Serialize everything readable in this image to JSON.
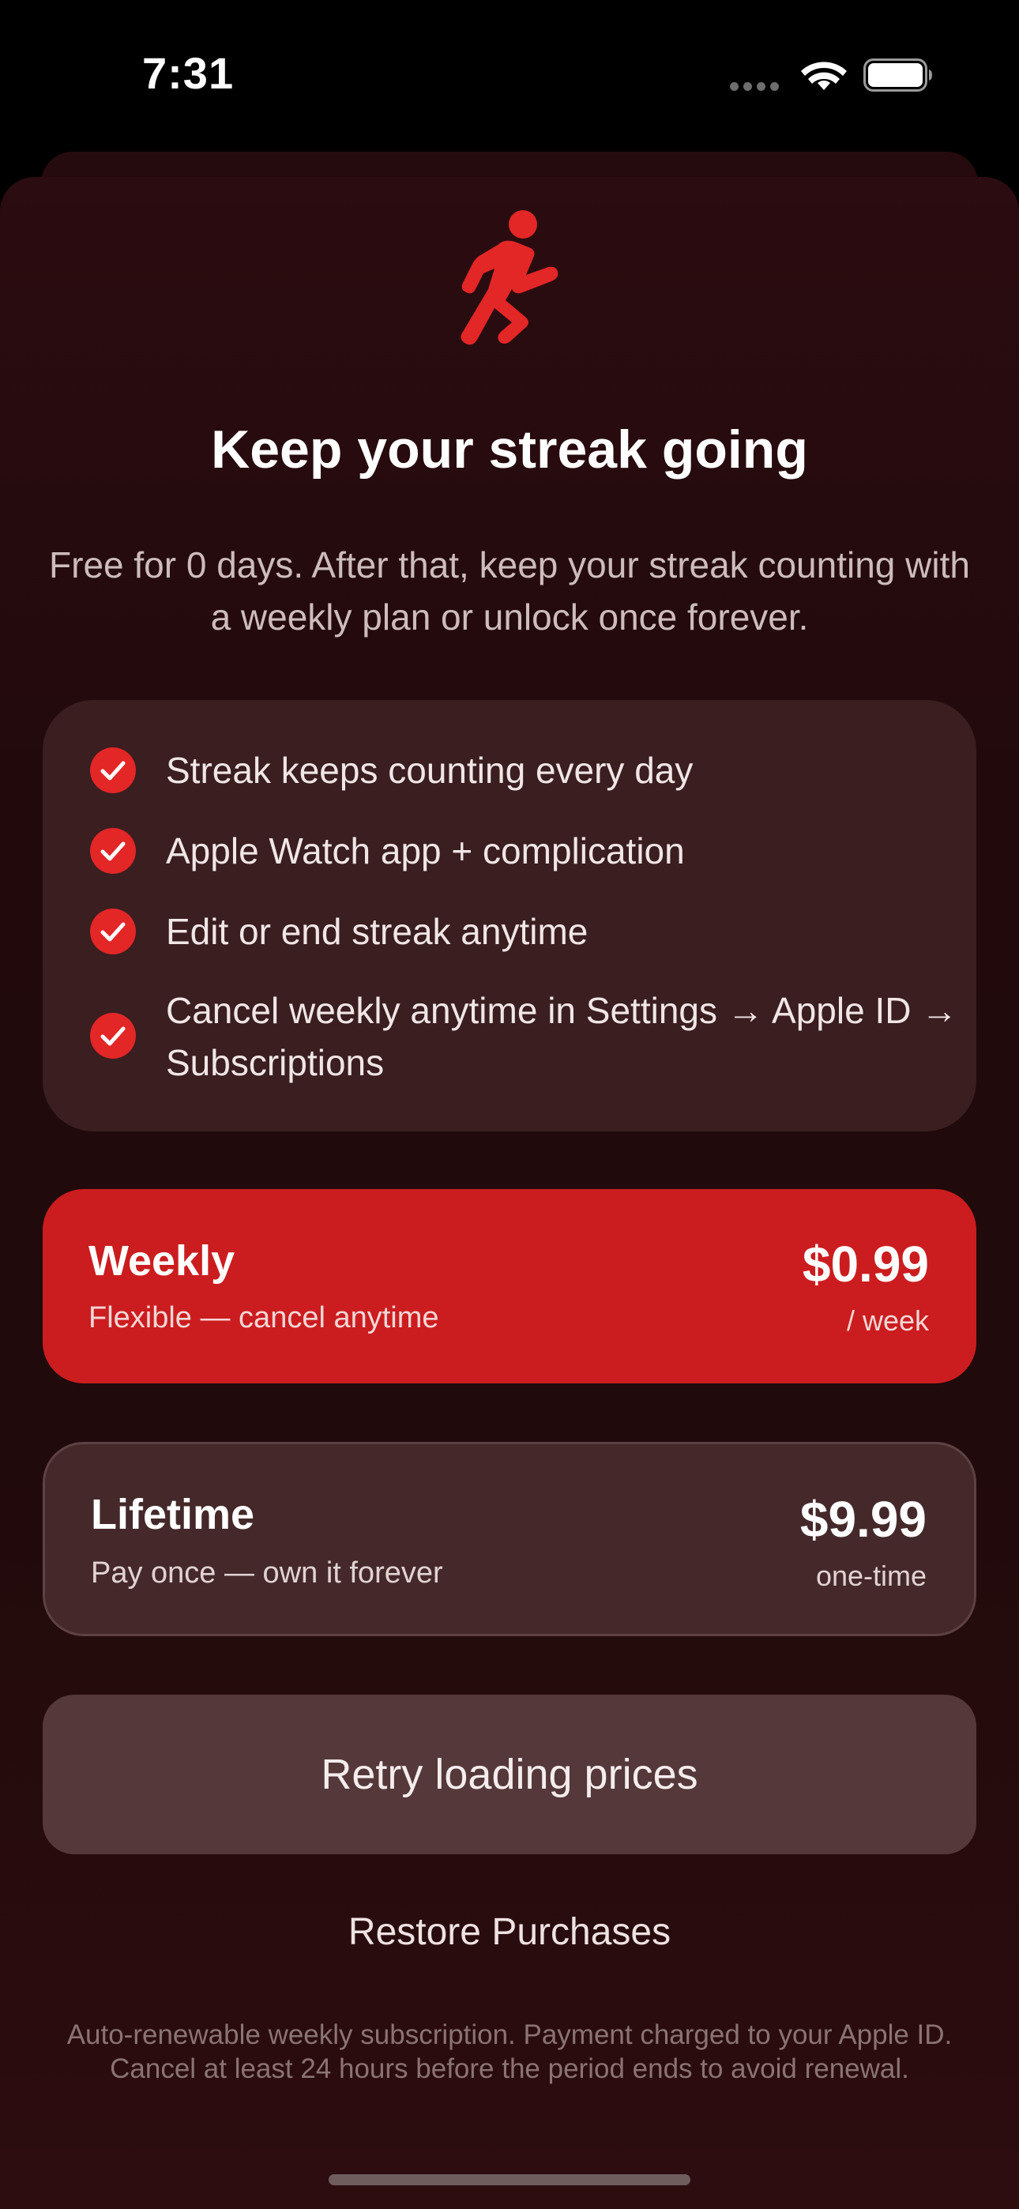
{
  "status_bar": {
    "time": "7:31"
  },
  "header": {
    "icon": "running-figure-icon",
    "title": "Keep your streak going",
    "subtitle": "Free for 0 days. After that, keep your streak counting with a weekly plan or unlock once forever."
  },
  "features": [
    {
      "label": "Streak keeps counting every day"
    },
    {
      "label": "Apple Watch app + complication"
    },
    {
      "label": "Edit or end streak anytime"
    },
    {
      "label": "Cancel weekly anytime in Settings → Apple ID → Subscriptions"
    }
  ],
  "plans": {
    "weekly": {
      "name": "Weekly",
      "description": "Flexible — cancel anytime",
      "price": "$0.99",
      "period": "/ week",
      "selected": true
    },
    "lifetime": {
      "name": "Lifetime",
      "description": "Pay once — own it forever",
      "price": "$9.99",
      "period": "one-time",
      "selected": false
    }
  },
  "actions": {
    "retry_label": "Retry loading prices",
    "restore_label": "Restore Purchases"
  },
  "legal_text": "Auto-renewable weekly subscription. Payment charged to your Apple ID. Cancel at least 24 hours before the period ends to avoid renewal.",
  "colors": {
    "accent": "#cb1d1f",
    "background": "#220a0c",
    "card": "#3a1e20"
  }
}
